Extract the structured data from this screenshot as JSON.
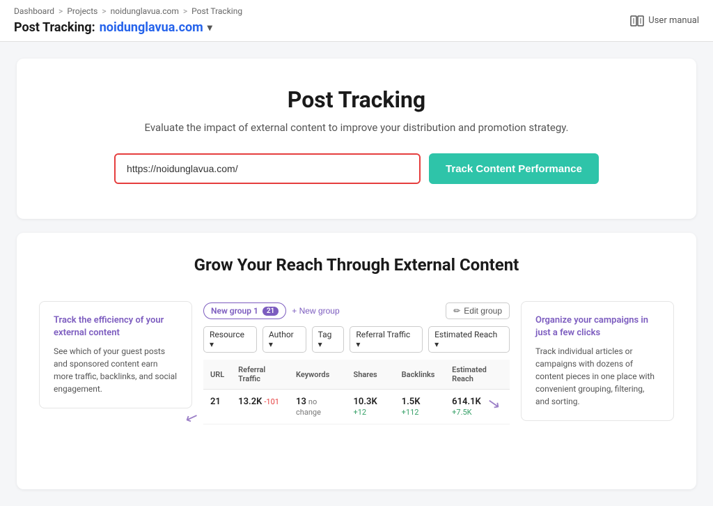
{
  "topbar": {
    "breadcrumb": {
      "items": [
        "Dashboard",
        "Projects",
        "noidunglavua.com",
        "Post Tracking"
      ],
      "separators": [
        ">",
        ">",
        ">"
      ]
    },
    "page_title": "Post Tracking:",
    "domain": "noidunglavua.com",
    "dropdown_icon": "▾",
    "user_manual_label": "User manual"
  },
  "search_section": {
    "title": "Post Tracking",
    "description": "Evaluate the impact of external content to improve your distribution and promotion strategy.",
    "input_value": "https://noidunglavua.com/",
    "input_placeholder": "https://noidunglavua.com/",
    "button_label": "Track Content Performance"
  },
  "features_section": {
    "title": "Grow Your Reach Through External Content",
    "feature_left": {
      "heading": "Track the efficiency of your external content",
      "body": "See which of your guest posts and sponsored content earn more traffic, backlinks, and social engagement."
    },
    "feature_right": {
      "heading": "Organize your campaigns in just a few clicks",
      "body": "Track individual articles or campaigns with dozens of content pieces in one place with convenient grouping, filtering, and sorting."
    },
    "group_tag_label": "New group 1",
    "group_tag_count": "21",
    "new_group_btn": "+ New group",
    "edit_group_btn": "Edit group",
    "filters": [
      "Resource ▾",
      "Author ▾",
      "Tag ▾",
      "Referral Traffic ▾",
      "Estimated Reach ▾"
    ],
    "table": {
      "headers": [
        "URL",
        "Referral Traffic",
        "Keywords",
        "Shares",
        "Backlinks",
        "Estimated Reach"
      ],
      "row": {
        "url_count": "21",
        "referral": "13.2K",
        "referral_delta": "-101",
        "keywords": "13",
        "keywords_note": "no change",
        "shares": "10.3K",
        "shares_delta": "+12",
        "backlinks": "1.5K",
        "backlinks_delta": "+112",
        "reach": "614.1K",
        "reach_delta": "+7.5K"
      }
    }
  },
  "colors": {
    "accent_teal": "#2ec4a9",
    "accent_purple": "#7c5cbf",
    "link_blue": "#2563eb",
    "danger_red": "#e53e3e"
  }
}
